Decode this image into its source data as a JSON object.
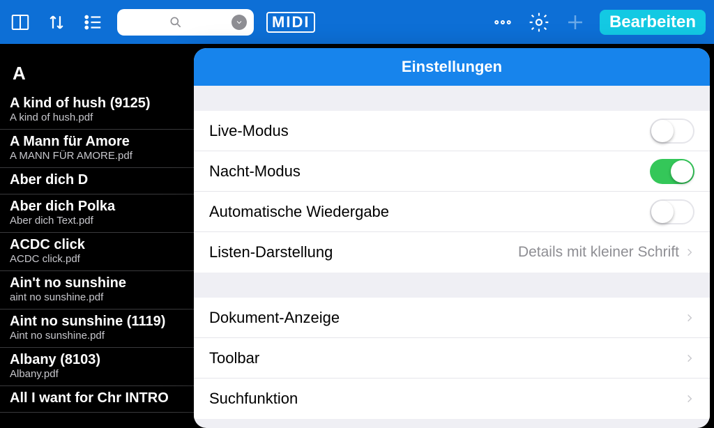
{
  "toolbar": {
    "midi_label": "MIDI",
    "edit_label": "Bearbeiten"
  },
  "songlist": {
    "section": "A",
    "items": [
      {
        "title": "A kind of hush (9125)",
        "sub": "A kind of hush.pdf"
      },
      {
        "title": "A Mann für Amore",
        "sub": "A MANN FÜR AMORE.pdf"
      },
      {
        "title": "Aber dich D",
        "sub": ""
      },
      {
        "title": "Aber dich Polka",
        "sub": "Aber dich Text.pdf"
      },
      {
        "title": "ACDC click",
        "sub": "ACDC click.pdf"
      },
      {
        "title": "Ain't no sunshine",
        "sub": "aint no sunshine.pdf"
      },
      {
        "title": "Aint no sunshine (1119)",
        "sub": "Aint no sunshine.pdf"
      },
      {
        "title": "Albany (8103)",
        "sub": "Albany.pdf"
      },
      {
        "title": "All I want for Chr INTRO",
        "sub": ""
      }
    ]
  },
  "settings": {
    "title": "Einstellungen",
    "rows1": [
      {
        "label": "Live-Modus",
        "type": "switch",
        "on": false
      },
      {
        "label": "Nacht-Modus",
        "type": "switch",
        "on": true
      },
      {
        "label": "Automatische Wiedergabe",
        "type": "switch",
        "on": false
      },
      {
        "label": "Listen-Darstellung",
        "type": "nav",
        "detail": "Details mit kleiner Schrift"
      }
    ],
    "rows2": [
      {
        "label": "Dokument-Anzeige",
        "type": "nav"
      },
      {
        "label": "Toolbar",
        "type": "nav"
      },
      {
        "label": "Suchfunktion",
        "type": "nav"
      }
    ]
  }
}
